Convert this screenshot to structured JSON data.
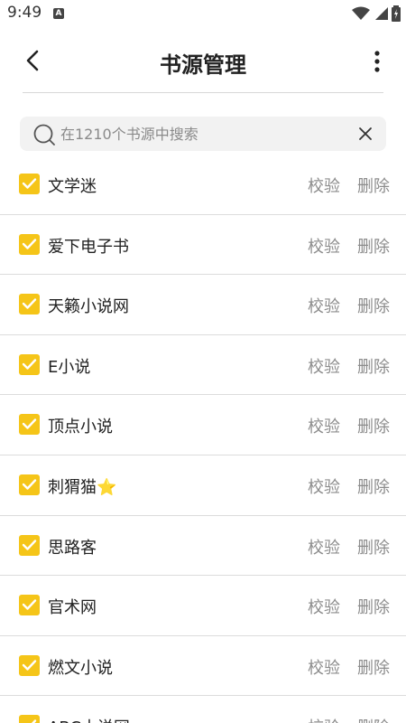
{
  "status_bar": {
    "time": "9:49",
    "badge": "A"
  },
  "header": {
    "title": "书源管理"
  },
  "search": {
    "placeholder": "在1210个书源中搜索"
  },
  "actions": {
    "verify": "校验",
    "delete": "删除"
  },
  "colors": {
    "accent": "#f5c518",
    "action_text": "#8c8c8c"
  },
  "sources": [
    {
      "name": "文学迷",
      "checked": true
    },
    {
      "name": "爱下电子书",
      "checked": true
    },
    {
      "name": "天籁小说网",
      "checked": true
    },
    {
      "name": "E小说",
      "checked": true
    },
    {
      "name": "顶点小说",
      "checked": true
    },
    {
      "name": "刺猬猫⭐",
      "checked": true
    },
    {
      "name": "思路客",
      "checked": true
    },
    {
      "name": "官术网",
      "checked": true
    },
    {
      "name": "燃文小说",
      "checked": true
    },
    {
      "name": "ABC小说网",
      "checked": true
    }
  ]
}
